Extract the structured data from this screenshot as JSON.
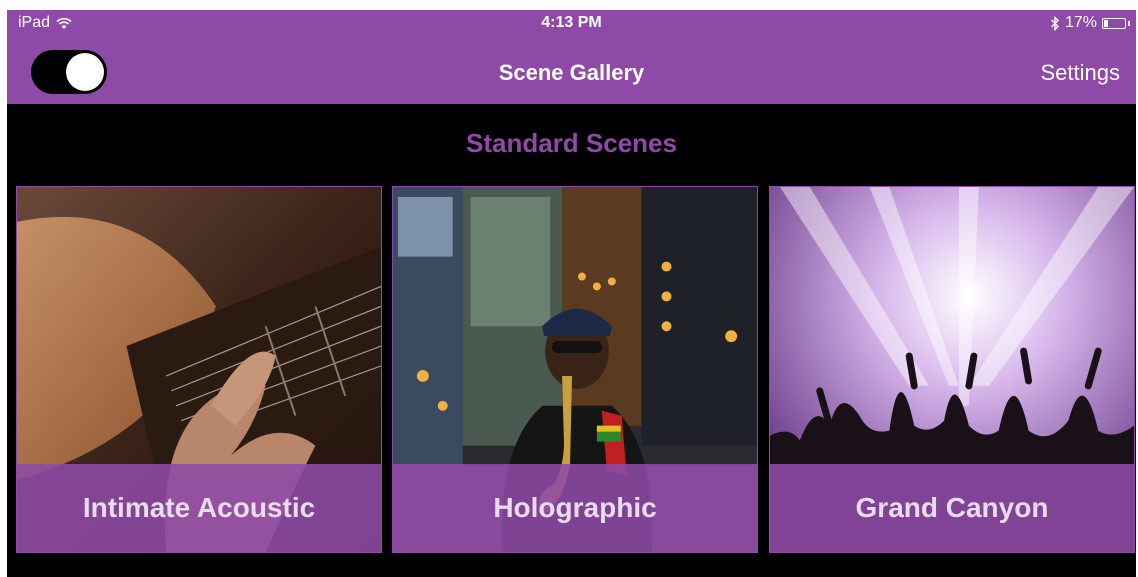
{
  "status_bar": {
    "device": "iPad",
    "wifi_icon": "wifi-icon",
    "time": "4:13 PM",
    "bluetooth_icon": "bluetooth-icon",
    "battery_percent": "17%",
    "battery_level": 0.17
  },
  "nav": {
    "toggle_on": true,
    "title": "Scene Gallery",
    "settings_label": "Settings"
  },
  "section_title": "Standard Scenes",
  "colors": {
    "accent": "#8e4aa6",
    "background": "#000000"
  },
  "scenes": [
    {
      "label": "Intimate Acoustic",
      "image": "acoustic-guitar-closeup"
    },
    {
      "label": "Holographic",
      "image": "saxophone-player-city-night"
    },
    {
      "label": "Grand Canyon",
      "image": "concert-crowd-stage-lights"
    }
  ]
}
